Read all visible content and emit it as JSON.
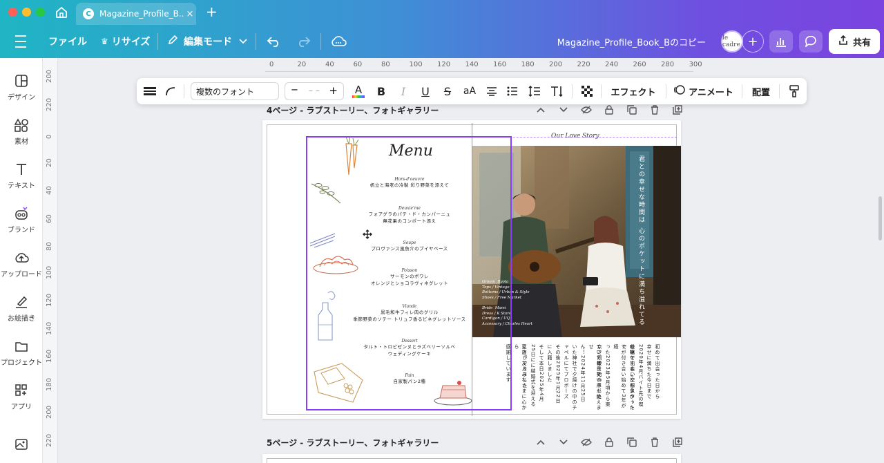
{
  "browser": {
    "tab_title": "Magazine_Profile_B...",
    "tab_favicon": "C",
    "tab_close": "×",
    "new_tab": "+"
  },
  "header": {
    "file": "ファイル",
    "resize": "リサイズ",
    "edit_mode": "編集モード",
    "doc_name": "Magazine_Profile_Book_Bのコピー",
    "avatar_text": "le cadre",
    "share": "共有",
    "plus": "+"
  },
  "sidebar": {
    "items": [
      {
        "label": "デザイン",
        "icon": "layout-icon"
      },
      {
        "label": "素材",
        "icon": "elements-icon"
      },
      {
        "label": "テキスト",
        "icon": "text-icon"
      },
      {
        "label": "ブランド",
        "icon": "brand-icon"
      },
      {
        "label": "アップロード",
        "icon": "upload-cloud-icon"
      },
      {
        "label": "お絵描き",
        "icon": "draw-icon"
      },
      {
        "label": "プロジェクト",
        "icon": "folder-icon"
      },
      {
        "label": "アプリ",
        "icon": "apps-icon"
      }
    ]
  },
  "rulers": {
    "horizontal": [
      "0",
      "20",
      "40",
      "60",
      "80",
      "100",
      "120",
      "140",
      "160",
      "180",
      "200",
      "220",
      "240",
      "260",
      "280",
      "300"
    ],
    "vertical": [
      "200",
      "220",
      "0",
      "20",
      "40",
      "60",
      "80",
      "100",
      "120",
      "140",
      "160",
      "180",
      "200",
      "220"
    ]
  },
  "toolbar": {
    "font": "複数のフォント",
    "size_minus": "−",
    "size_value": "– –",
    "size_plus": "+",
    "text_color": "A",
    "bold": "B",
    "italic": "I",
    "underline": "U",
    "strike": "S",
    "case": "aA",
    "effects": "エフェクト",
    "animate": "アニメート",
    "position": "配置"
  },
  "pages": {
    "page4_title": "4ページ - ラブストーリー、フォトギャラリー",
    "page5_title": "5ページ - ラブストーリー、フォトギャラリー"
  },
  "menu": {
    "title": "Menu",
    "courses": [
      {
        "name": "Hors-d'oeuvre",
        "dishes": [
          "帆立と海老の冷製 彩り野菜を添えて"
        ]
      },
      {
        "name": "Deuxie'me",
        "dishes": [
          "フォアグラのパテ・ド・カンパーニュ",
          "無花果のコンポート添え"
        ]
      },
      {
        "name": "Soupe",
        "dishes": [
          "プロヴァンス風魚介のブイヤベース"
        ]
      },
      {
        "name": "Poisson",
        "dishes": [
          "サーモンのポワレ",
          "オレンジとショコラヴィネグレット"
        ]
      },
      {
        "name": "Viande",
        "dishes": [
          "黒毛和牛フィレ肉のグリル",
          "季節野菜のソテー トリュフ香るビネグレットソース"
        ]
      },
      {
        "name": "Dessert",
        "dishes": [
          "タルト・トロピゼンヌとラズベリーソルベ",
          "ウェディングケーキ"
        ]
      },
      {
        "name": "Pain",
        "dishes": [
          "自家製パン2種"
        ]
      }
    ]
  },
  "story": {
    "heading": "Our Love Story",
    "photo_caption": "君との幸せな時間は 心のポケットに満ち溢れてる",
    "credits_groom": "Groom  Ryota\nTops / Vintage\nBottoms / Urban & Style\nShoes / Free Market",
    "credits_bride": "Bride  Mami\nDress / K Store\nCardigan / UQ\nAccessory / Charles Heart",
    "body_columns": [
      "初めて出会った日から",
      "幸せに満ちた今日まで",
      "2020年4月バイト先の喫",
      "茶店で出会い交際スタート",
      "喧嘩をすることも多かったで",
      "すが付き合い始めて3年が経",
      "った2023年5月頃から東",
      "京で同棲を始めました",
      "ていて毎日笑い声が絶えませ",
      "ん！2024年11月25日",
      "いた神社で夕焼けの中のチ",
      "ャペルにてプロポーズ",
      "その後2025年1月22日",
      "に入籍しました",
      "そして本日2025年4月",
      "25日にに結婚式を迎える",
      "ことができました",
      "家族、友人みなさまに心から",
      "感謝しています"
    ]
  },
  "colors": {
    "accent": "#8b3dff",
    "header_start": "#1fb5c4",
    "header_end": "#7b43e0"
  }
}
